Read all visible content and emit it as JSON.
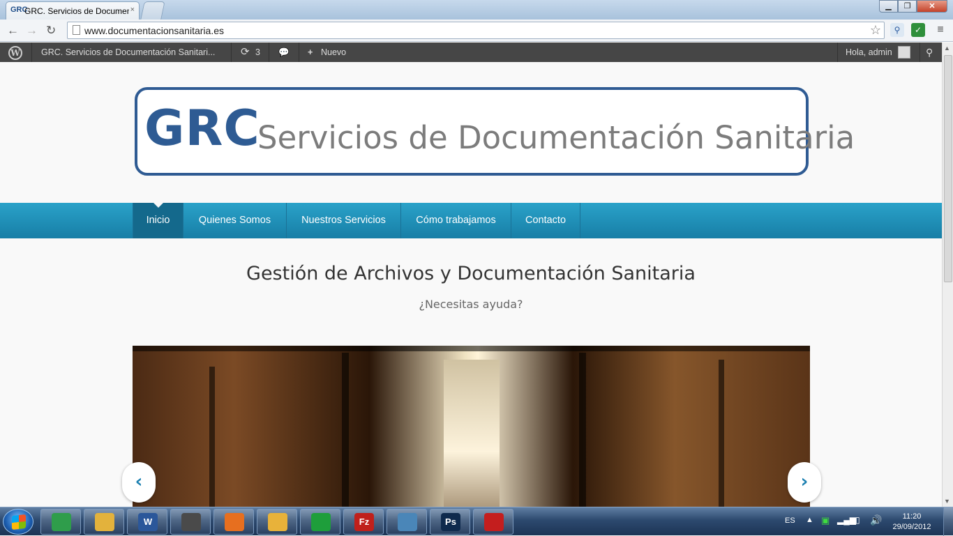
{
  "browser": {
    "tab_favicon": "GRC",
    "tab_title": "GRC. Servicios de Documentación Sanitaria",
    "tab_close": "×",
    "url": "www.documentacionsanitaria.es",
    "back_icon": "←",
    "forward_icon": "→",
    "reload_icon": "↻",
    "star_icon": "☆"
  },
  "admin_bar": {
    "site_name": "GRC. Servicios de Documentación Sanitari...",
    "updates_count": "3",
    "new_label": "Nuevo",
    "greeting": "Hola, admin"
  },
  "header": {
    "logo_grc": "GRC",
    "logo_subtitle": "Servicios de Documentación Sanitaria"
  },
  "nav": {
    "items": [
      {
        "label": "Inicio"
      },
      {
        "label": "Quienes Somos"
      },
      {
        "label": "Nuestros Servicios"
      },
      {
        "label": "Cómo trabajamos"
      },
      {
        "label": "Contacto"
      }
    ]
  },
  "hero": {
    "headline": "Gestión de Archivos y Documentación Sanitaria",
    "subline": "¿Necesitas ayuda?",
    "prev_icon": "‹",
    "next_icon": "›"
  },
  "taskbar": {
    "apps": [
      {
        "name": "chrome",
        "color": "#2f9d4b"
      },
      {
        "name": "explorer",
        "color": "#e3b23c"
      },
      {
        "name": "word",
        "color": "#2b579a",
        "glyph": "W"
      },
      {
        "name": "game",
        "color": "#4a4a4a"
      },
      {
        "name": "firefox",
        "color": "#e76f1f"
      },
      {
        "name": "outlook",
        "color": "#e8b23a"
      },
      {
        "name": "spotify",
        "color": "#1e9e3b"
      },
      {
        "name": "filezilla",
        "color": "#c0201b",
        "glyph": "Fz"
      },
      {
        "name": "photos",
        "color": "#4a86b8"
      },
      {
        "name": "photoshop",
        "color": "#0f2a4d",
        "glyph": "Ps"
      },
      {
        "name": "acrobat",
        "color": "#c41e1e"
      }
    ],
    "language": "ES",
    "time": "11:20",
    "date": "29/09/2012"
  }
}
